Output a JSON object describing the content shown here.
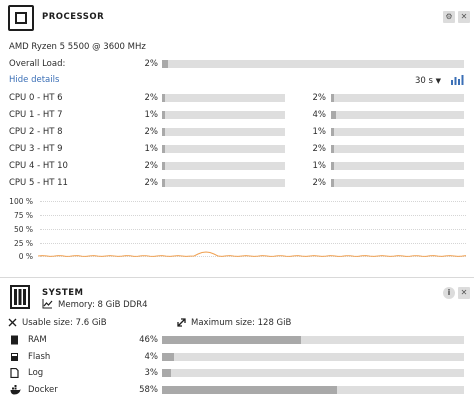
{
  "processor": {
    "title": "PROCESSOR",
    "model": "AMD Ryzen 5 5500 @ 3600 MHz",
    "overall_label": "Overall Load:",
    "overall_pct": "2%",
    "overall_value": 2,
    "hide_details": "Hide details",
    "interval": "30 s",
    "interval_arrow": "▼",
    "icons": {
      "settings": "gear-icon",
      "close": "close-icon",
      "chart": "bar-chart-icon",
      "cpu": "cpu-icon"
    },
    "cores": [
      {
        "label": "CPU 0 - HT 6",
        "a_pct": "2%",
        "a": 2,
        "b_pct": "2%",
        "b": 2
      },
      {
        "label": "CPU 1 - HT 7",
        "a_pct": "1%",
        "a": 1,
        "b_pct": "4%",
        "b": 4
      },
      {
        "label": "CPU 2 - HT 8",
        "a_pct": "2%",
        "a": 2,
        "b_pct": "1%",
        "b": 1
      },
      {
        "label": "CPU 3 - HT 9",
        "a_pct": "1%",
        "a": 1,
        "b_pct": "2%",
        "b": 2
      },
      {
        "label": "CPU 4 - HT 10",
        "a_pct": "2%",
        "a": 2,
        "b_pct": "1%",
        "b": 1
      },
      {
        "label": "CPU 5 - HT 11",
        "a_pct": "2%",
        "a": 2,
        "b_pct": "2%",
        "b": 2
      }
    ],
    "graph": {
      "y_labels": [
        "100 %",
        "75 %",
        "50 %",
        "25 %",
        "0 %"
      ],
      "line_color": "#f0a050"
    }
  },
  "system": {
    "title": "SYSTEM",
    "memory": "Memory: 8 GiB DDR4",
    "usable": "Usable size: 7.6 GiB",
    "maximum": "Maximum size: 128 GiB",
    "icons": {
      "info": "info-icon",
      "close": "close-icon",
      "memory": "memory-icon",
      "chart": "line-chart-icon"
    },
    "items": [
      {
        "label": "RAM",
        "pct": "46%",
        "value": 46,
        "icon": "ram-icon"
      },
      {
        "label": "Flash",
        "pct": "4%",
        "value": 4,
        "icon": "flash-icon"
      },
      {
        "label": "Log",
        "pct": "3%",
        "value": 3,
        "icon": "log-icon"
      },
      {
        "label": "Docker",
        "pct": "58%",
        "value": 58,
        "icon": "docker-icon"
      }
    ]
  }
}
